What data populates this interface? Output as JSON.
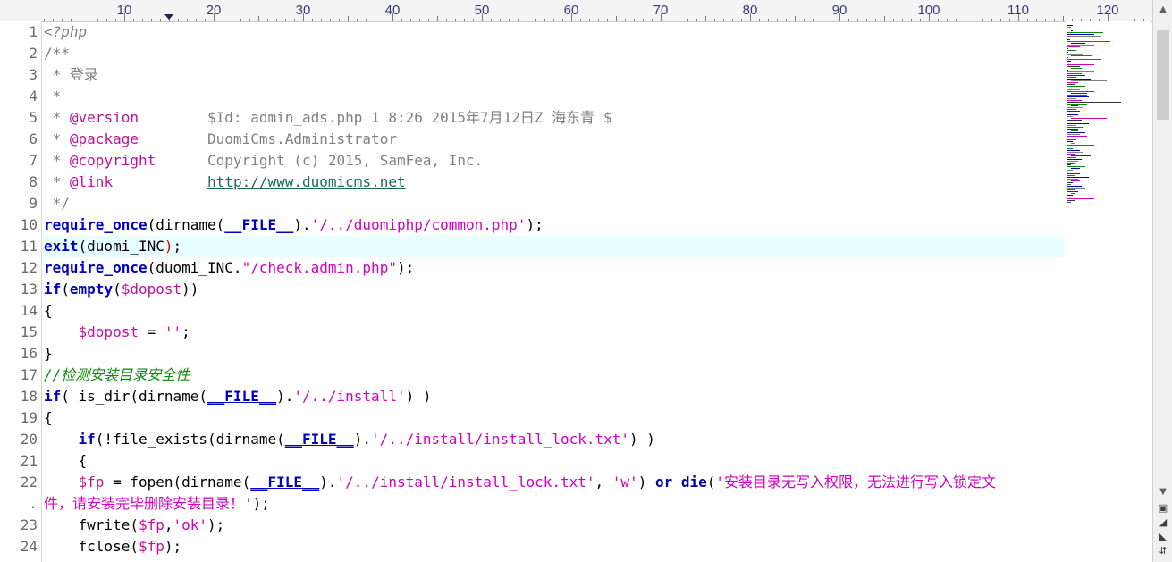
{
  "ruler": {
    "labels": [
      "10",
      "20",
      "30",
      "40",
      "50",
      "60",
      "70",
      "80",
      "90",
      "100",
      "110",
      "120"
    ]
  },
  "line_numbers": [
    "1",
    "2",
    "3",
    "4",
    "5",
    "6",
    "7",
    "8",
    "9",
    "10",
    "11",
    "12",
    "13",
    "14",
    "15",
    "16",
    "17",
    "18",
    "19",
    "20",
    "21",
    "22",
    ".",
    "23",
    "24"
  ],
  "code": {
    "l1": "<?php",
    "l2": "/**",
    "l3": " * 登录",
    "l4": " *",
    "l5_star": " * ",
    "l5_tag": "@version",
    "l5_val": "        $Id: admin_ads.php 1 8:26 2015年7月12日Z 海东青 $",
    "l6_star": " * ",
    "l6_tag": "@package",
    "l6_val": "        DuomiCms.Administrator",
    "l7_star": " * ",
    "l7_tag": "@copyright",
    "l7_val": "      Copyright (c) 2015, SamFea, Inc.",
    "l8_star": " * ",
    "l8_tag": "@link",
    "l8_pad": "           ",
    "l8_link": "http://www.duomicms.net",
    "l9": " */",
    "l10_a": "require_once",
    "l10_b": "(dirname(",
    "l10_c": "__FILE__",
    "l10_d": ").",
    "l10_e": "'/../duomiphp/common.php'",
    "l10_f": ");",
    "l11_a": "exit",
    "l11_b": "(duomi_INC",
    "l11_c": ")",
    "l11_d": ";",
    "l12_a": "require_once",
    "l12_b": "(duomi_INC.",
    "l12_c": "\"/check.admin.php\"",
    "l12_d": ");",
    "l13_a": "if",
    "l13_b": "(",
    "l13_c": "empty",
    "l13_d": "(",
    "l13_e": "$dopost",
    "l13_f": "))",
    "l14": "{",
    "l15_pad": "    ",
    "l15_var": "$dopost",
    "l15_eq": " = ",
    "l15_str": "''",
    "l15_end": ";",
    "l16": "}",
    "l17": "//检测安装目录安全性",
    "l18_a": "if",
    "l18_b": "( is_dir(dirname(",
    "l18_c": "__FILE__",
    "l18_d": ").",
    "l18_e": "'/../install'",
    "l18_f": ") )",
    "l19": "{",
    "l20_pad": "    ",
    "l20_a": "if",
    "l20_b": "(!file_exists(dirname(",
    "l20_c": "__FILE__",
    "l20_d": ").",
    "l20_e": "'/../install/install_lock.txt'",
    "l20_f": ") )",
    "l21": "    {",
    "l22_pad": "    ",
    "l22_var": "$fp",
    "l22_b": " = fopen(dirname(",
    "l22_c": "__FILE__",
    "l22_d": ").",
    "l22_e": "'/../install/install_lock.txt'",
    "l22_f": ", ",
    "l22_g": "'w'",
    "l22_h": ") ",
    "l22_or": "or",
    "l22_sp": " ",
    "l22_die": "die",
    "l22_i": "(",
    "l22_j": "'安装目录无写入权限，无法进行写入锁定文",
    "l22w_a": "件，请安装完毕删除安装目录！'",
    "l22w_b": ");",
    "l23_pad": "    fwrite(",
    "l23_var": "$fp",
    "l23_c": ",",
    "l23_str": "'ok'",
    "l23_d": ");",
    "l24_pad": "    fclose(",
    "l24_var": "$fp",
    "l24_d": ");"
  },
  "colors": {
    "keyword": "#0000c0",
    "string": "#d000c0",
    "comment": "#808080",
    "comment_cn": "#0a8a0a",
    "current_line": "#e8ffff"
  }
}
